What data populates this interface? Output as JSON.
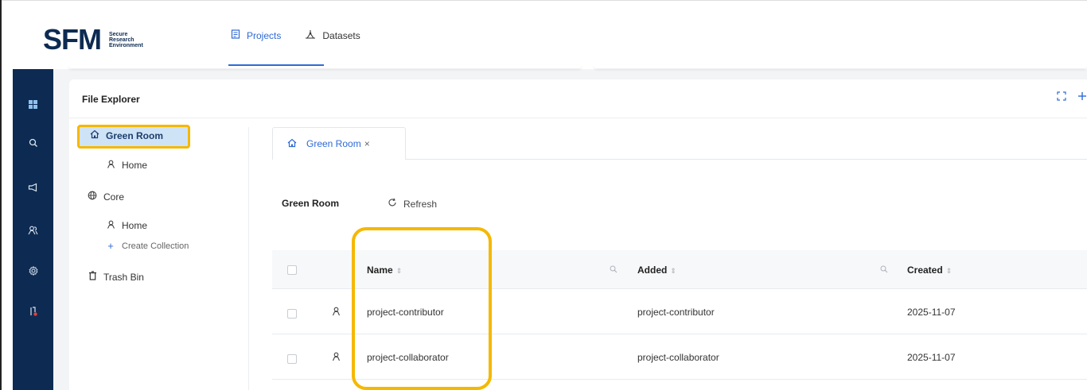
{
  "app": {
    "logo_main": "SFM",
    "logo_sub": [
      "Secure",
      "Research",
      "Environment"
    ]
  },
  "nav": {
    "projects_label": "Projects",
    "datasets_label": "Datasets"
  },
  "sidebar": {
    "items": [
      {
        "icon": "dashboard-icon"
      },
      {
        "icon": "search-icon"
      },
      {
        "icon": "megaphone-icon"
      },
      {
        "icon": "users-icon"
      },
      {
        "icon": "settings-icon"
      },
      {
        "icon": "pull-request-icon"
      }
    ]
  },
  "panel": {
    "title": "File Explorer"
  },
  "tree": {
    "green_room": "Green Room",
    "green_room_home": "Home",
    "core": "Core",
    "core_home": "Home",
    "create_collection": "Create Collection",
    "trash_bin": "Trash Bin"
  },
  "tab": {
    "label": "Green Room",
    "close": "×"
  },
  "toolbar": {
    "section_title": "Green Room",
    "refresh_label": "Refresh"
  },
  "table": {
    "columns": {
      "name": "Name",
      "added": "Added",
      "created": "Created"
    },
    "rows": [
      {
        "name": "project-contributor",
        "added": "project-contributor",
        "created": "2025-11-07"
      },
      {
        "name": "project-collaborator",
        "added": "project-collaborator",
        "created": "2025-11-07"
      }
    ]
  },
  "colors": {
    "brand_navy": "#0d2b52",
    "accent_blue": "#2f6ad6",
    "highlight_yellow": "#f5b800",
    "selected_bg": "#cfe3f7"
  }
}
